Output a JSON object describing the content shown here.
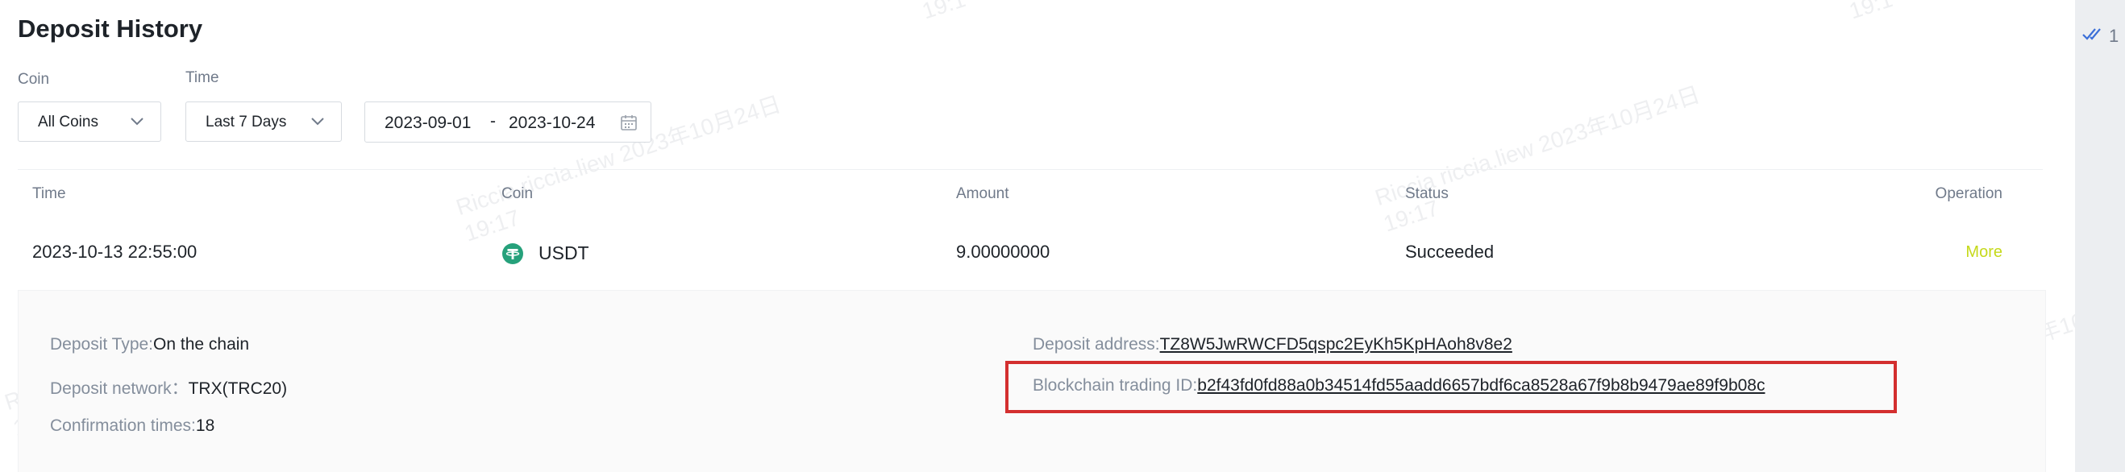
{
  "page": {
    "title": "Deposit History"
  },
  "filters": {
    "coin_label": "Coin",
    "coin_value": "All Coins",
    "time_label": "Time",
    "time_value": "Last 7 Days",
    "date_start": "2023-09-01",
    "date_separator": "-",
    "date_end": "2023-10-24"
  },
  "table": {
    "headers": [
      "Time",
      "Coin",
      "Amount",
      "Status",
      "Operation"
    ],
    "row": {
      "time": "2023-10-13 22:55:00",
      "coin": "USDT",
      "amount": "9.00000000",
      "status": "Succeeded",
      "operation": "More"
    }
  },
  "details": {
    "deposit_type_label": "Deposit Type:",
    "deposit_type_value": "On the chain",
    "deposit_network_label": "Deposit network：",
    "deposit_network_value": "TRX(TRC20)",
    "confirmation_label": "Confirmation times:",
    "confirmation_value": "18",
    "deposit_address_label": "Deposit address:",
    "deposit_address_value": "TZ8W5JwRWCFD5qspc2EyKh5KpHAoh8v8e2",
    "blockchain_id_label": "Blockchain trading ID:",
    "blockchain_id_value": "b2f43fd0fd88a0b34514fd55aadd6657bdf6ca8528a67f9b8b9479ae89f9b08c"
  },
  "side": {
    "count_text": "1"
  },
  "watermarks": {
    "line1": "Riccia riccia.liew 2023年10月24日",
    "line2": "19:17",
    "short1": "10月24日",
    "short2": "19:1"
  },
  "colors": {
    "accent_more": "#c5d91a",
    "usdt_green": "#26a17b",
    "highlight_red": "#d32f2f",
    "check_blue": "#3b6fd8"
  },
  "icons": {
    "coin_icon": "usdt-tether-icon",
    "calendar": "calendar-icon",
    "dropdown": "chevron-down-icon",
    "read_check": "double-check-icon"
  }
}
